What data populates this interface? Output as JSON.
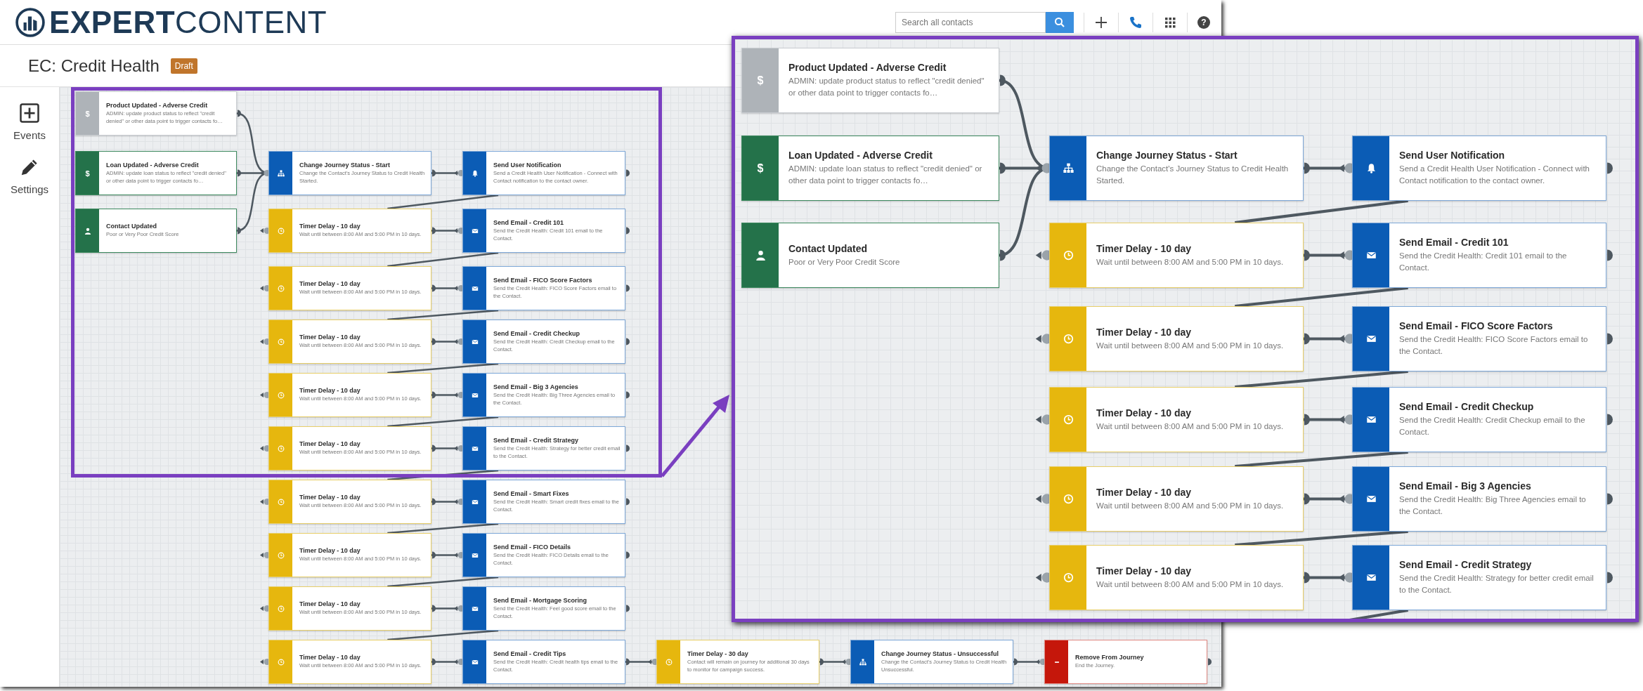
{
  "header": {
    "logo": "**EXPERT**CONTENT",
    "search": {
      "placeholder": "Search all contacts"
    },
    "help_glyph": "?"
  },
  "page": {
    "title": "EC: Credit Health",
    "status_badge": "Draft"
  },
  "sidebar": {
    "items": [
      {
        "kind": "events",
        "label": "Events"
      },
      {
        "kind": "settings",
        "label": "Settings"
      }
    ]
  },
  "workflow": {
    "triggers": [
      {
        "kind": "product",
        "glyph": "$",
        "title": "Product Updated - Adverse Credit",
        "description": "ADMIN: update product status to reflect \"credit denied\" or other data point to trigger contacts fo…"
      },
      {
        "kind": "loan",
        "glyph": "$",
        "title": "Loan Updated - Adverse Credit",
        "description": "ADMIN: update loan status to reflect \"credit denied\" or other data point to trigger contacts fo…"
      },
      {
        "kind": "contact",
        "title": "Contact Updated",
        "description": "Poor or Very Poor Credit Score"
      }
    ],
    "steps": [
      {
        "nodes": [
          {
            "kind": "status",
            "title": "Change Journey Status - Start",
            "description": "Change the Contact's Journey Status to Credit Health Started."
          },
          {
            "kind": "notification",
            "title": "Send User Notification",
            "description": "Send a Credit Health User Notification - Connect with Contact notification to the contact owner."
          }
        ]
      },
      {
        "nodes": [
          {
            "kind": "timer",
            "title": "Timer Delay - 10 day",
            "description": "Wait until between 8:00 AM and 5:00 PM in 10 days."
          },
          {
            "kind": "email",
            "title": "Send Email - Credit 101",
            "description": "Send the Credit Health: Credit 101 email to the Contact."
          }
        ]
      },
      {
        "nodes": [
          {
            "kind": "timer",
            "title": "Timer Delay - 10 day",
            "description": "Wait until between 8:00 AM and 5:00 PM in 10 days."
          },
          {
            "kind": "email",
            "title": "Send Email - FICO Score Factors",
            "description": "Send the Credit Health: FICO Score Factors email to the Contact."
          }
        ]
      },
      {
        "nodes": [
          {
            "kind": "timer",
            "title": "Timer Delay - 10 day",
            "description": "Wait until between 8:00 AM and 5:00 PM in 10 days."
          },
          {
            "kind": "email",
            "title": "Send Email - Credit Checkup",
            "description": "Send the Credit Health: Credit Checkup email to the Contact."
          }
        ]
      },
      {
        "nodes": [
          {
            "kind": "timer",
            "title": "Timer Delay - 10 day",
            "description": "Wait until between 8:00 AM and 5:00 PM in 10 days."
          },
          {
            "kind": "email",
            "title": "Send Email - Big 3 Agencies",
            "description": "Send the Credit Health: Big Three Agencies email to the Contact."
          }
        ]
      },
      {
        "nodes": [
          {
            "kind": "timer",
            "title": "Timer Delay - 10 day",
            "description": "Wait until between 8:00 AM and 5:00 PM in 10 days."
          },
          {
            "kind": "email",
            "title": "Send Email - Credit Strategy",
            "description": "Send the Credit Health: Strategy for better credit email to the Contact."
          }
        ]
      },
      {
        "nodes": [
          {
            "kind": "timer",
            "title": "Timer Delay - 10 day",
            "description": "Wait until between 8:00 AM and 5:00 PM in 10 days."
          },
          {
            "kind": "email",
            "title": "Send Email - Smart Fixes",
            "description": "Send the Credit Health: Smart credit fixes email to the Contact."
          }
        ]
      },
      {
        "nodes": [
          {
            "kind": "timer",
            "title": "Timer Delay - 10 day",
            "description": "Wait until between 8:00 AM and 5:00 PM in 10 days."
          },
          {
            "kind": "email",
            "title": "Send Email - FICO Details",
            "description": "Send the Credit Health: FICO Details email to the Contact."
          }
        ]
      },
      {
        "nodes": [
          {
            "kind": "timer",
            "title": "Timer Delay - 10 day",
            "description": "Wait until between 8:00 AM and 5:00 PM in 10 days."
          },
          {
            "kind": "email",
            "title": "Send Email - Mortgage Scoring",
            "description": "Send the Credit Health: Feel good score email to the Contact."
          }
        ]
      },
      {
        "nodes": [
          {
            "kind": "timer",
            "title": "Timer Delay - 10 day",
            "description": "Wait until between 8:00 AM and 5:00 PM in 10 days."
          },
          {
            "kind": "email",
            "title": "Send Email - Credit Tips",
            "description": "Send the Credit Health: Credit health tips email to the Contact."
          },
          {
            "kind": "timer",
            "title": "Timer Delay - 30 day",
            "description": "Contact will remain on journey for additional 30 days to monitor for campaign success."
          },
          {
            "kind": "status",
            "title": "Change Journey Status - Unsuccessful",
            "description": "Change the Contact's Journey Status to Credit Health Unsuccessful."
          },
          {
            "kind": "remove",
            "title": "Remove From Journey",
            "description": "End the Journey."
          }
        ]
      }
    ]
  },
  "zoom_panel": {
    "triggers": [
      {
        "kind": "product",
        "glyph": "$",
        "title": "Product Updated - Adverse Credit",
        "description": "ADMIN: update product status to reflect \"credit denied\" or other data point to trigger contacts fo…"
      },
      {
        "kind": "loan",
        "glyph": "$",
        "title": "Loan Updated - Adverse Credit",
        "description": "ADMIN: update loan status to reflect \"credit denied\" or other data point to trigger contacts fo…"
      },
      {
        "kind": "contact",
        "title": "Contact Updated",
        "description": "Poor or Very Poor Credit Score"
      }
    ],
    "steps": [
      {
        "nodes": [
          {
            "kind": "status",
            "title": "Change Journey Status - Start",
            "description": "Change the Contact's Journey Status to Credit Health Started."
          },
          {
            "kind": "notification",
            "title": "Send User Notification",
            "description": "Send a Credit Health User Notification - Connect with Contact notification to the contact owner."
          }
        ]
      },
      {
        "nodes": [
          {
            "kind": "timer",
            "title": "Timer Delay - 10 day",
            "description": "Wait until between 8:00 AM and 5:00 PM in 10 days."
          },
          {
            "kind": "email",
            "title": "Send Email - Credit 101",
            "description": "Send the Credit Health: Credit 101 email to the Contact."
          }
        ]
      },
      {
        "nodes": [
          {
            "kind": "timer",
            "title": "Timer Delay - 10 day",
            "description": "Wait until between 8:00 AM and 5:00 PM in 10 days."
          },
          {
            "kind": "email",
            "title": "Send Email - FICO Score Factors",
            "description": "Send the Credit Health: FICO Score Factors email to the Contact."
          }
        ]
      },
      {
        "nodes": [
          {
            "kind": "timer",
            "title": "Timer Delay - 10 day",
            "description": "Wait until between 8:00 AM and 5:00 PM in 10 days."
          },
          {
            "kind": "email",
            "title": "Send Email - Credit Checkup",
            "description": "Send the Credit Health: Credit Checkup email to the Contact."
          }
        ]
      },
      {
        "nodes": [
          {
            "kind": "timer",
            "title": "Timer Delay - 10 day",
            "description": "Wait until between 8:00 AM and 5:00 PM in 10 days."
          },
          {
            "kind": "email",
            "title": "Send Email - Big 3 Agencies",
            "description": "Send the Credit Health: Big Three Agencies email to the Contact."
          }
        ]
      },
      {
        "nodes": [
          {
            "kind": "timer",
            "title": "Timer Delay - 10 day",
            "description": "Wait until between 8:00 AM and 5:00 PM in 10 days."
          },
          {
            "kind": "email",
            "title": "Send Email - Credit Strategy",
            "description": "Send the Credit Health: Strategy for better credit email to the Contact."
          }
        ]
      }
    ]
  }
}
